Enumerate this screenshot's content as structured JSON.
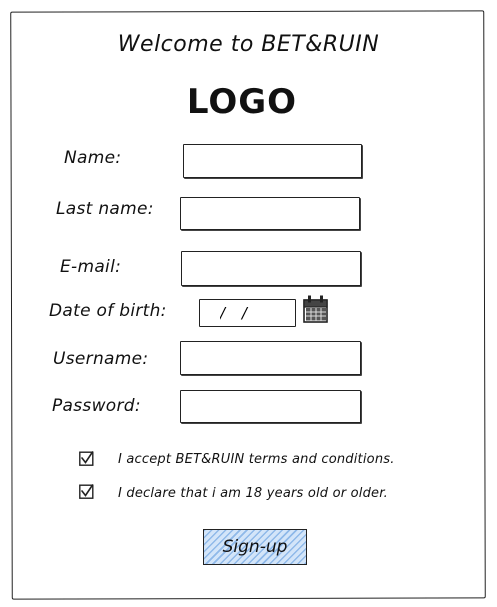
{
  "header": {
    "welcome_text": "Welcome to BET&RUIN",
    "logo_text": "LOGO"
  },
  "form": {
    "name_label": "Name:",
    "name_value": "",
    "last_name_label": "Last name:",
    "last_name_value": "",
    "email_label": "E-mail:",
    "email_value": "",
    "dob_label": "Date of birth:",
    "dob_value": "/ /",
    "username_label": "Username:",
    "username_value": "",
    "password_label": "Password:",
    "password_value": ""
  },
  "agreements": {
    "terms_text": "I accept BET&RUIN terms and conditions.",
    "terms_checked": true,
    "age_text": "I declare that i am 18 years old or older.",
    "age_checked": true
  },
  "actions": {
    "signup_label": "Sign-up"
  },
  "colors": {
    "button_fill": "#bcd7f5",
    "button_hatch": "#8fb9e9",
    "ink": "#222222"
  },
  "icons": {
    "calendar": "calendar-icon",
    "checkbox": "checkbox-checked-icon"
  }
}
